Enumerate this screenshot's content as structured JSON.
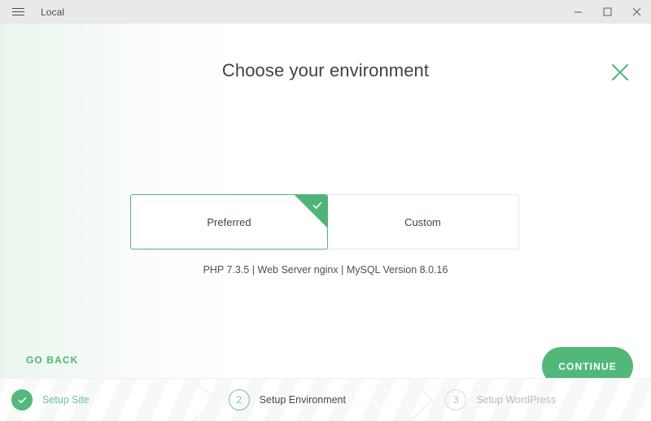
{
  "window": {
    "title": "Local",
    "menu_icon": "hamburger-icon",
    "controls": {
      "minimize": "minimize-icon",
      "maximize": "maximize-icon",
      "close": "close-icon"
    }
  },
  "main": {
    "heading": "Choose your environment",
    "close_icon": "close-icon",
    "cards": [
      {
        "label": "Preferred",
        "selected": true,
        "check_icon": "check-icon"
      },
      {
        "label": "Custom",
        "selected": false
      }
    ],
    "environment_summary": "PHP 7.3.5 | Web Server nginx | MySQL Version 8.0.16",
    "go_back_label": "GO BACK",
    "continue_label": "CONTINUE"
  },
  "stepper": {
    "steps": [
      {
        "marker": "check-icon",
        "label": "Setup Site",
        "state": "done"
      },
      {
        "marker": "2",
        "label": "Setup Environment",
        "state": "active"
      },
      {
        "marker": "3",
        "label": "Setup WordPress",
        "state": "todo"
      }
    ]
  },
  "colors": {
    "accent_green": "#4fb477",
    "button_green": "#51b87a",
    "titlebar_bg": "#e9e9e9",
    "heading_text": "#3c4447"
  }
}
